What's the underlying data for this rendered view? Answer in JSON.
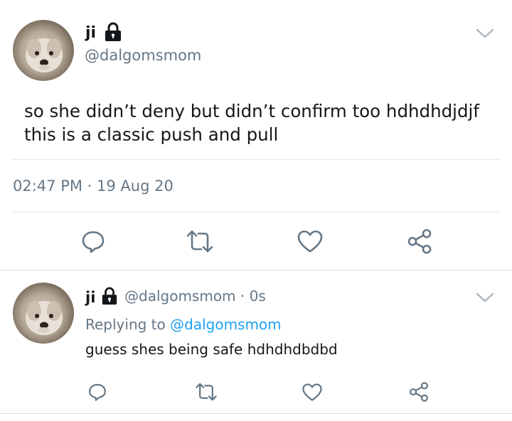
{
  "main_tweet": {
    "display_name": "ji",
    "handle": "@dalgomsmom",
    "text_lines": [
      "so she didn’t deny but didn’t confirm too hdhdhdjdjf",
      "this is a classic push and pull"
    ],
    "timestamp": "02:47 PM · 19 Aug 20",
    "actions": [
      "reply-icon",
      "retweet-icon",
      "like-icon",
      "share-icon"
    ]
  },
  "reply_tweet": {
    "display_name": "ji",
    "handle": "@dalgomsmom",
    "time_separator": "·",
    "time": "0s",
    "replying_prefix": "Replying to",
    "replying_to": "@dalgomsmom",
    "text": "guess shes being safe hdhdhdbdbd",
    "actions": [
      "reply-icon",
      "retweet-icon",
      "like-icon",
      "share-icon"
    ]
  },
  "colors": {
    "text_primary": "#14171a",
    "text_secondary": "#657786",
    "link": "#1da1f2",
    "divider": "#e1e8ed",
    "icon": "#657786"
  }
}
